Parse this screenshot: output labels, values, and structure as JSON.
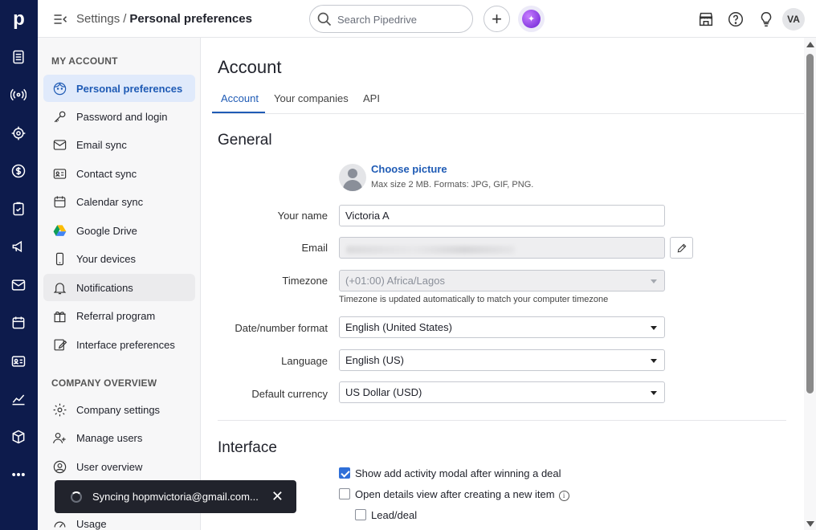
{
  "rail": {
    "logo": "p",
    "icons": [
      "deals-icon",
      "leads-icon",
      "target-icon",
      "dollar-icon",
      "tasks-icon",
      "megaphone-icon",
      "mail-icon",
      "calendar-icon",
      "contacts-icon",
      "insights-icon",
      "products-icon",
      "more-icon"
    ]
  },
  "topbar": {
    "breadcrumb_parent": "Settings",
    "breadcrumb_separator": "/",
    "breadcrumb_current": "Personal preferences",
    "search_placeholder": "Search Pipedrive",
    "add_label": "+",
    "ai_label": "✦",
    "avatar_initials": "VA"
  },
  "sidebar": {
    "my_account_title": "MY ACCOUNT",
    "company_title": "COMPANY OVERVIEW",
    "items": [
      {
        "label": "Personal preferences"
      },
      {
        "label": "Password and login"
      },
      {
        "label": "Email sync"
      },
      {
        "label": "Contact sync"
      },
      {
        "label": "Calendar sync"
      },
      {
        "label": "Google Drive"
      },
      {
        "label": "Your devices"
      },
      {
        "label": "Notifications"
      },
      {
        "label": "Referral program"
      },
      {
        "label": "Interface preferences"
      }
    ],
    "company_items": [
      {
        "label": "Company settings"
      },
      {
        "label": "Manage users"
      },
      {
        "label": "User overview"
      },
      {
        "label": "Usage"
      }
    ]
  },
  "toast": {
    "text": "Syncing hopmvictoria@gmail.com...",
    "close": "✕"
  },
  "main": {
    "title": "Account",
    "tabs": [
      {
        "label": "Account"
      },
      {
        "label": "Your companies"
      },
      {
        "label": "API"
      }
    ],
    "general_title": "General",
    "choose_picture": "Choose picture",
    "picture_hint": "Max size 2 MB. Formats: JPG, GIF, PNG.",
    "fields": {
      "name_label": "Your name",
      "name_value": "Victoria A",
      "email_label": "Email",
      "timezone_label": "Timezone",
      "timezone_value": "(+01:00) Africa/Lagos",
      "timezone_hint": "Timezone is updated automatically to match your computer timezone",
      "date_label": "Date/number format",
      "date_value": "English (United States)",
      "language_label": "Language",
      "language_value": "English (US)",
      "currency_label": "Default currency",
      "currency_value": "US Dollar (USD)"
    },
    "interface_title": "Interface",
    "checkboxes": [
      {
        "label": "Show add activity modal after winning a deal",
        "checked": true
      },
      {
        "label": "Open details view after creating a new item",
        "checked": false
      },
      {
        "label": "Lead/deal",
        "checked": false
      }
    ],
    "info_glyph": "i"
  }
}
